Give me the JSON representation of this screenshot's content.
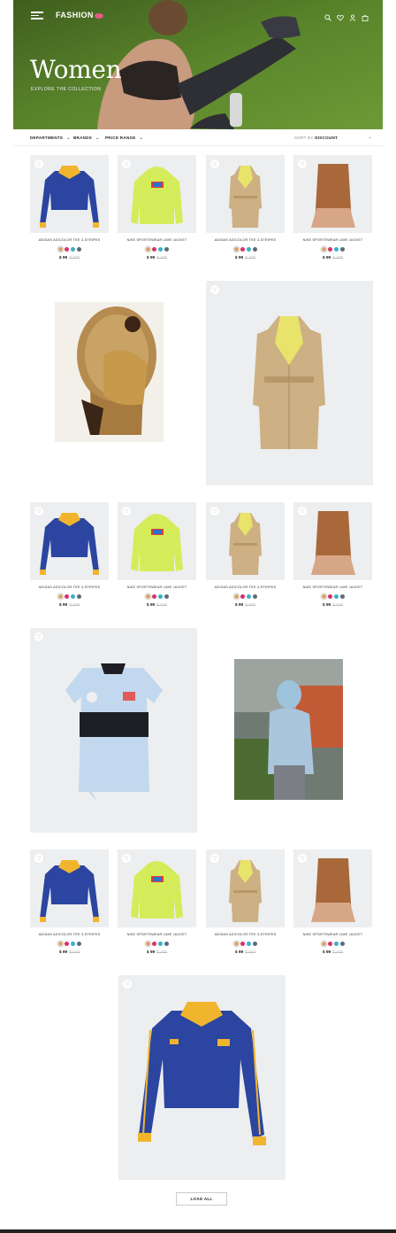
{
  "header": {
    "logo_text": "FASHION",
    "logo_mark_color": "#e35b88",
    "hero_title": "Women",
    "hero_subtitle": "EXPLORE THE COLLECTION",
    "icons": [
      "menu-icon",
      "search-icon",
      "heart-icon",
      "user-icon",
      "bag-icon"
    ]
  },
  "filters": {
    "departments": "DEPARTMENTS",
    "brands": "BRANDS",
    "price_range": "PRICE RANGE",
    "sort_prefix": "SORT BY",
    "sort_value": "DISCOUNT"
  },
  "products": [
    {
      "name": "ADIDAS ADICOLOR TEE 3-STRIPES",
      "price": "$ 99",
      "old_price": "$ 400",
      "kind": "rugby"
    },
    {
      "name": "NIKE SPORTSWEAR LIME JACKET",
      "price": "$ 99",
      "old_price": "$ 400",
      "kind": "hoodie"
    },
    {
      "name": "ADIDAS ADICOLOR TEE 3-STRIPES",
      "price": "$ 99",
      "old_price": "$ 400",
      "kind": "trench"
    },
    {
      "name": "NIKE SPORTSWEAR LIME JACKET",
      "price": "$ 99",
      "old_price": "$ 400",
      "kind": "dress"
    }
  ],
  "swatch_colors": [
    "#d9a36b",
    "#d6336c",
    "#3bb0c9",
    "#5a6c7a"
  ],
  "load_all": "LOAD ALL"
}
